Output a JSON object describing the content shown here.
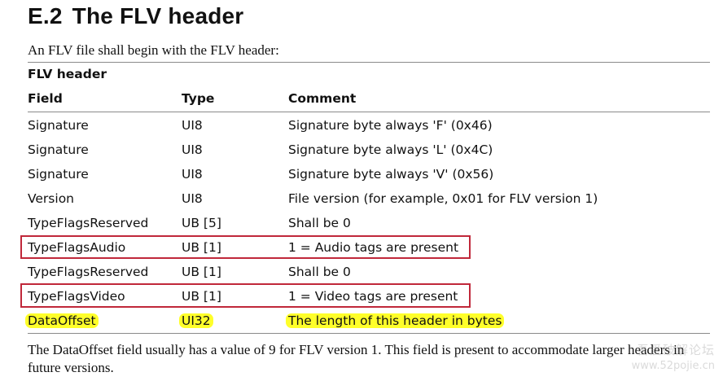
{
  "section": {
    "number": "E.2",
    "title": "The FLV header"
  },
  "intro": "An FLV file shall begin with the FLV header:",
  "table": {
    "caption": "FLV header",
    "headers": {
      "field": "Field",
      "type": "Type",
      "comment": "Comment"
    },
    "rows": [
      {
        "field": "Signature",
        "type": "UI8",
        "comment": "Signature byte always 'F' (0x46)"
      },
      {
        "field": "Signature",
        "type": "UI8",
        "comment": "Signature byte always 'L' (0x4C)"
      },
      {
        "field": "Signature",
        "type": "UI8",
        "comment": "Signature byte always 'V' (0x56)"
      },
      {
        "field": "Version",
        "type": "UI8",
        "comment": "File version (for example, 0x01 for FLV version 1)"
      },
      {
        "field": "TypeFlagsReserved",
        "type": "UB [5]",
        "comment": "Shall be 0"
      },
      {
        "field": "TypeFlagsAudio",
        "type": "UB [1]",
        "comment": "1 = Audio tags are present"
      },
      {
        "field": "TypeFlagsReserved",
        "type": "UB [1]",
        "comment": "Shall be 0"
      },
      {
        "field": "TypeFlagsVideo",
        "type": "UB [1]",
        "comment": "1 = Video tags are present"
      },
      {
        "field": "DataOffset",
        "type": "UI32",
        "comment": "The length of this header in bytes"
      }
    ]
  },
  "footer": "The DataOffset field usually has a value of 9 for FLV version 1. This field is present to accommodate larger headers in future versions.",
  "watermark": {
    "line1": "吾爱破解论坛",
    "line2": "www.52pojie.cn"
  },
  "colors": {
    "highlight_box": "#c0283a",
    "highlight_marker": "#ffff2a"
  }
}
